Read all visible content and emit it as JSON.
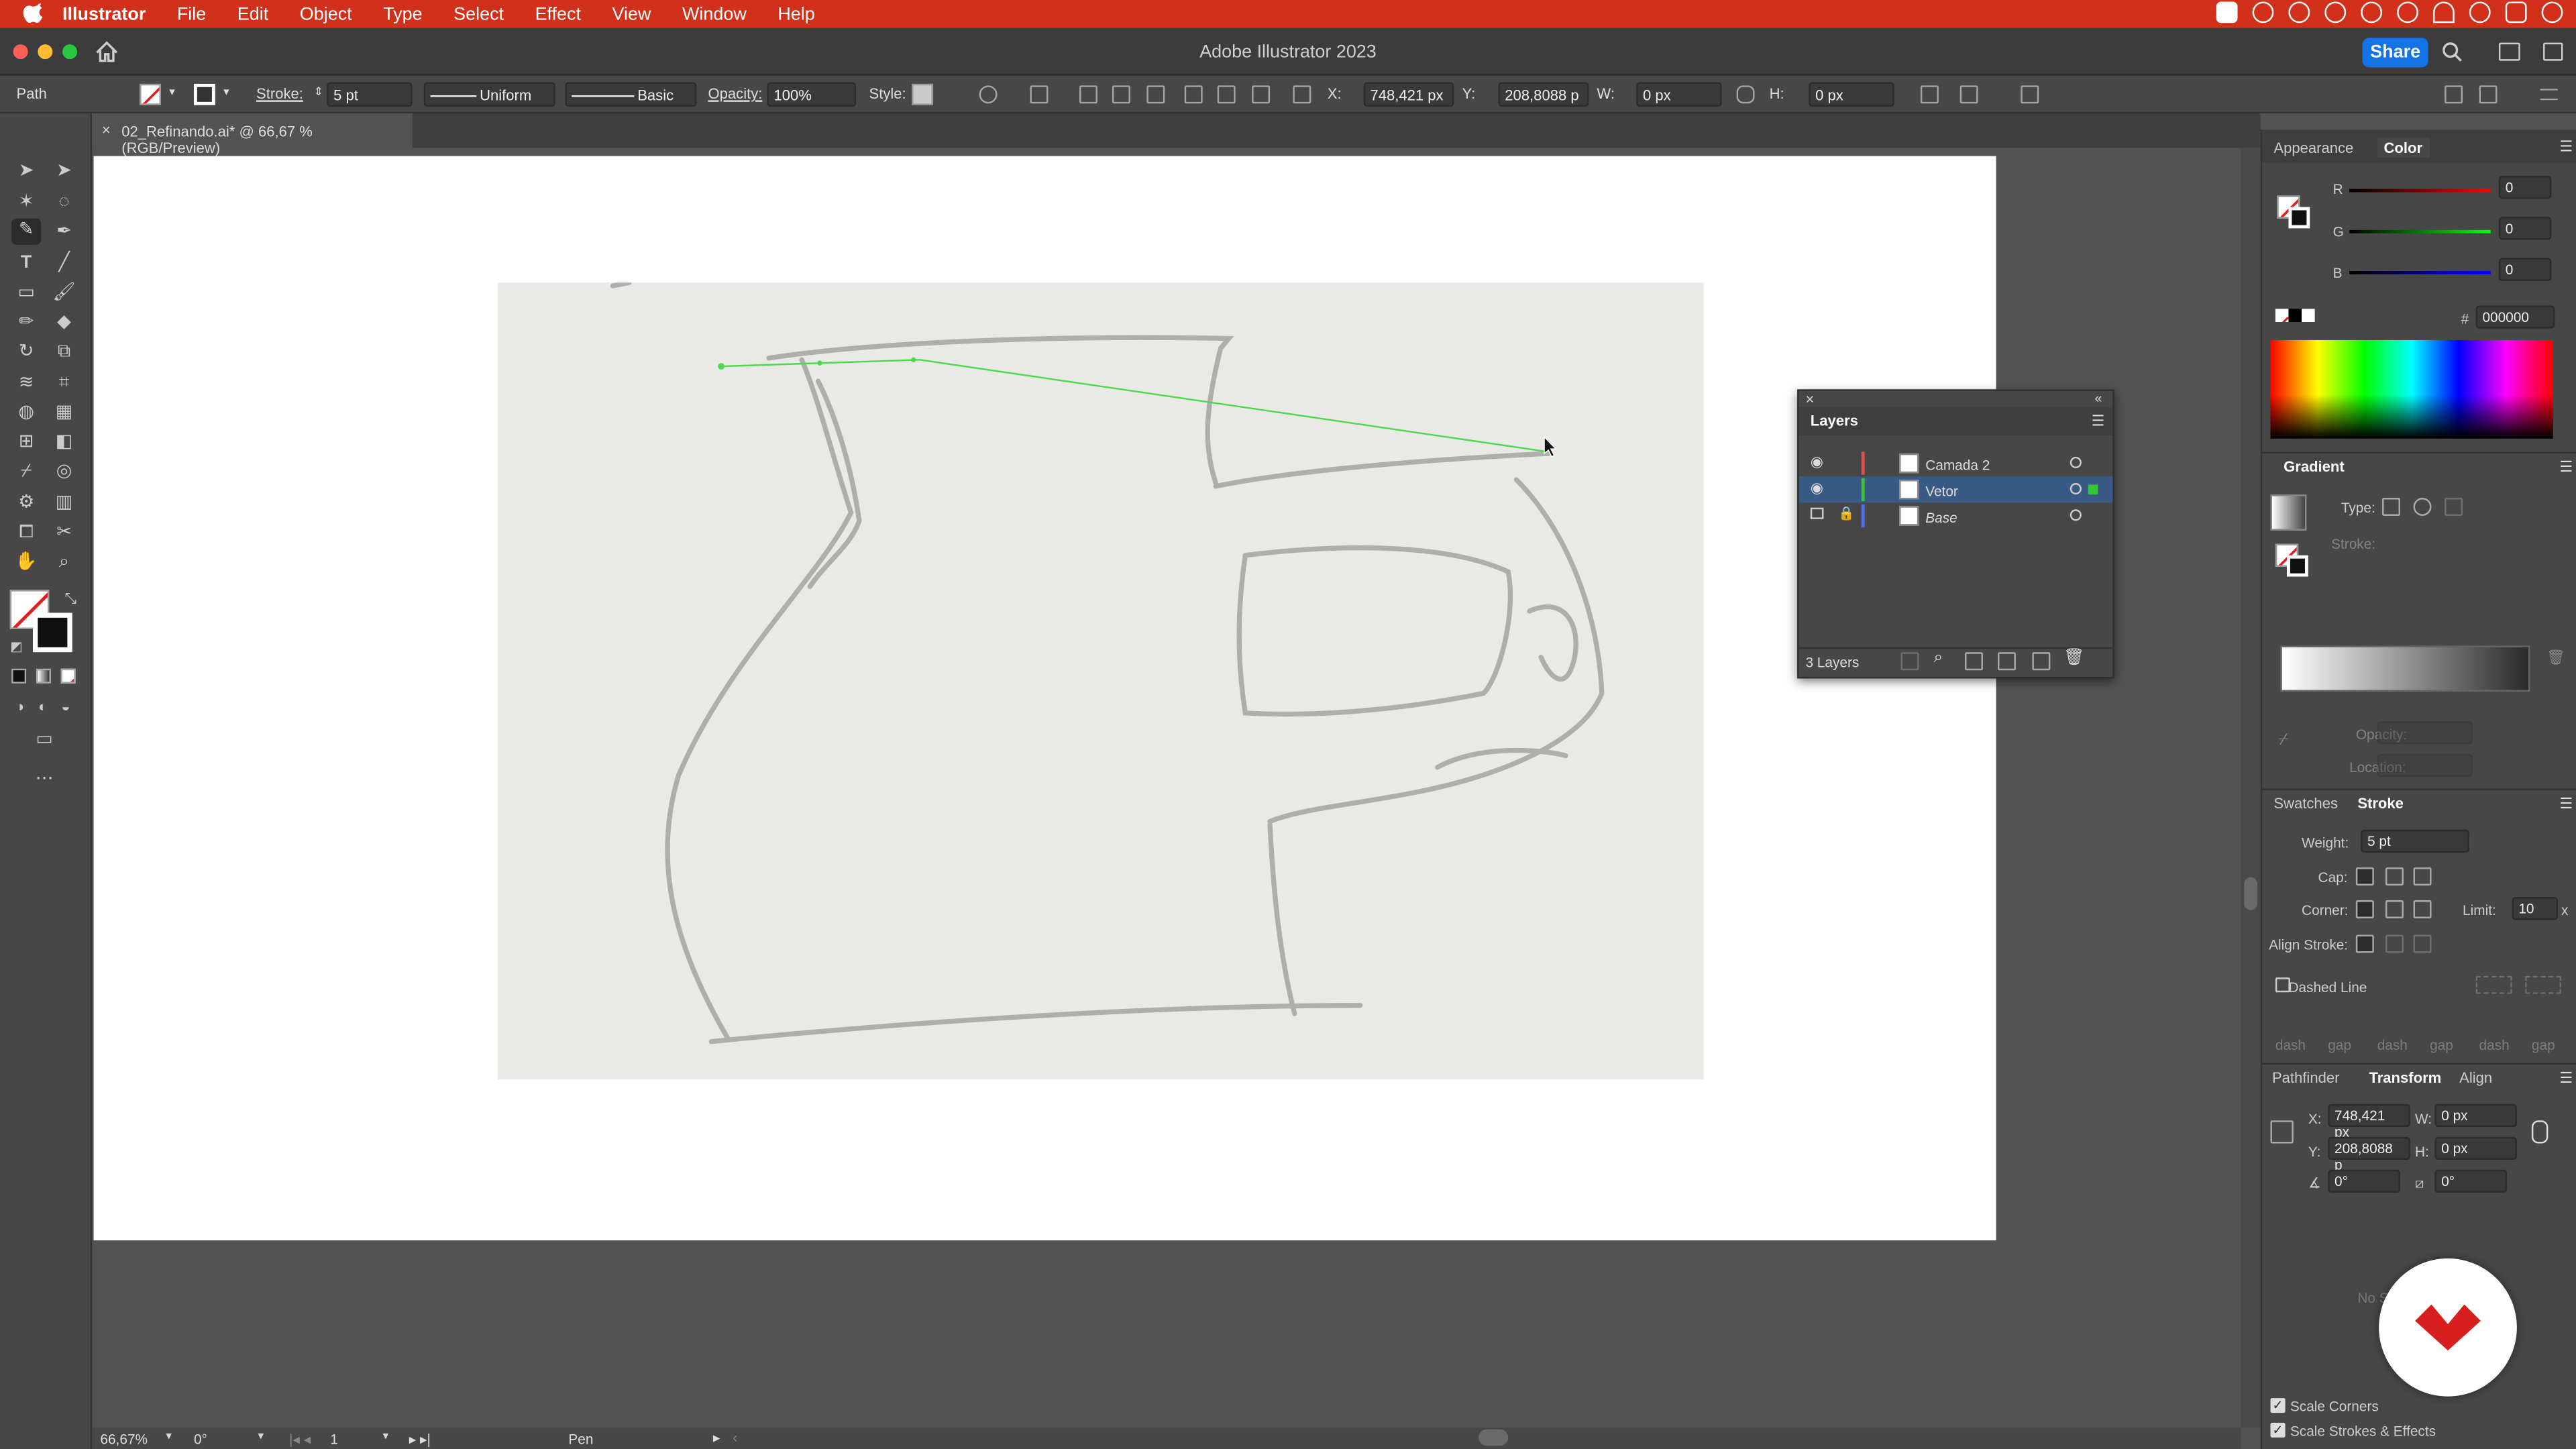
{
  "menubar": {
    "app": "Illustrator",
    "items": [
      "File",
      "Edit",
      "Object",
      "Type",
      "Select",
      "Effect",
      "View",
      "Window",
      "Help"
    ]
  },
  "titlebar": {
    "title": "Adobe Illustrator 2023",
    "share": "Share"
  },
  "control": {
    "selection": "Path",
    "stroke_label": "Stroke:",
    "stroke_value": "5 pt",
    "profile": "Uniform",
    "brush": "Basic",
    "opacity_label": "Opacity:",
    "opacity_value": "100%",
    "style_label": "Style:",
    "x_label": "X:",
    "x_value": "748,421 px",
    "y_label": "Y:",
    "y_value": "208,8088 p",
    "w_label": "W:",
    "w_value": "0 px",
    "h_label": "H:",
    "h_value": "0 px"
  },
  "document": {
    "tab": "02_Refinando.ai* @ 66,67 % (RGB/Preview)"
  },
  "layers": {
    "title": "Layers",
    "items": [
      {
        "name": "Camada 2",
        "color": "#e84b4b"
      },
      {
        "name": "Vetor",
        "color": "#35c535"
      },
      {
        "name": "Base",
        "color": "#4a6ff2"
      }
    ],
    "count": "3 Layers"
  },
  "color_panel": {
    "tabs": [
      "Appearance",
      "Color"
    ],
    "r_label": "R",
    "g_label": "G",
    "b_label": "B",
    "r": "0",
    "g": "0",
    "b": "0",
    "hash": "#",
    "hex": "000000"
  },
  "gradient_panel": {
    "title": "Gradient",
    "type_label": "Type:",
    "stroke_label": "Stroke:",
    "opacity_label": "Opacity:",
    "location_label": "Location:"
  },
  "stroke_panel": {
    "tabs": [
      "Swatches",
      "Stroke"
    ],
    "weight_label": "Weight:",
    "weight": "5 pt",
    "cap_label": "Cap:",
    "corner_label": "Corner:",
    "limit_label": "Limit:",
    "limit": "10",
    "limit_x": "x",
    "align_label": "Align Stroke:",
    "dashed_label": "Dashed Line",
    "dash_labels": [
      "dash",
      "gap",
      "dash",
      "gap",
      "dash",
      "gap"
    ]
  },
  "transform_panel": {
    "tabs": [
      "Pathfinder",
      "Transform",
      "Align"
    ],
    "x_label": "X:",
    "x": "748,421 px",
    "y_label": "Y:",
    "y": "208,8088 p",
    "w_label": "W:",
    "w": "0 px",
    "h_label": "H:",
    "h": "0 px",
    "angle": "0°",
    "shear": "0°",
    "no_st": "No St",
    "scale_corners": "Scale Corners",
    "scale_strokes": "Scale Strokes & Effects"
  },
  "status": {
    "zoom": "66,67%",
    "rotate": "0°",
    "artboard": "1",
    "tool": "Pen"
  }
}
